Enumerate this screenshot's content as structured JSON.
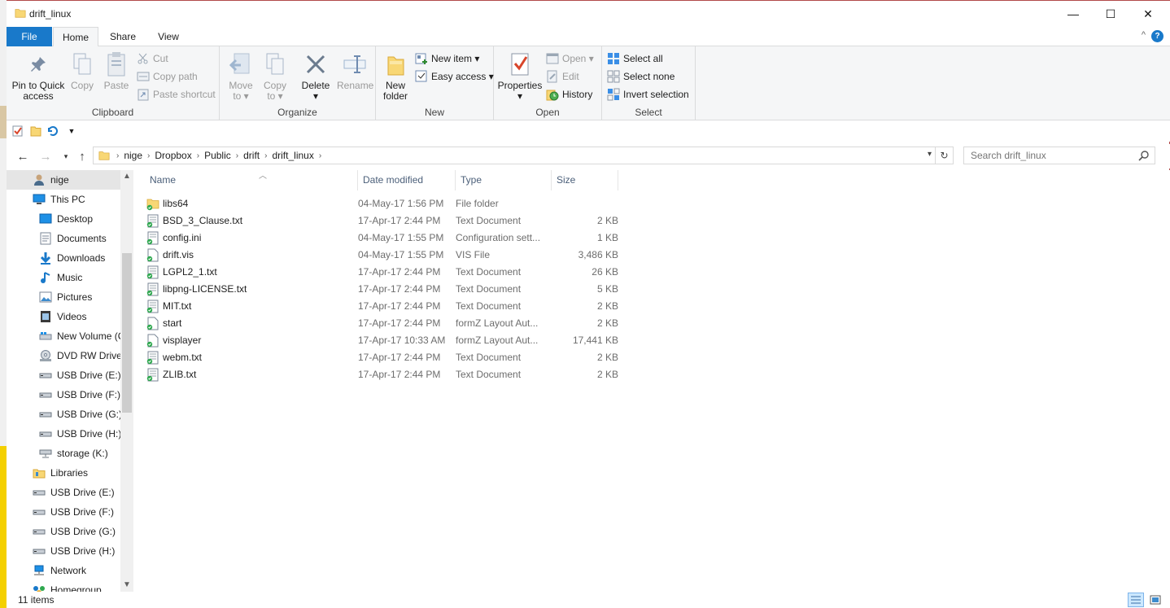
{
  "window": {
    "title": "drift_linux",
    "minimize_glyph": "—",
    "maximize_glyph": "☐",
    "close_glyph": "✕"
  },
  "ribbon_tabs": {
    "file": "File",
    "home": "Home",
    "share": "Share",
    "view": "View",
    "collapse_glyph": "^",
    "help_glyph": "?"
  },
  "ribbon": {
    "clipboard": {
      "title": "Clipboard",
      "pin_label_1": "Pin to Quick",
      "pin_label_2": "access",
      "copy": "Copy",
      "paste": "Paste",
      "cut": "Cut",
      "copy_path": "Copy path",
      "paste_shortcut": "Paste shortcut"
    },
    "organize": {
      "title": "Organize",
      "move_to_1": "Move",
      "move_to_2": "to",
      "copy_to_1": "Copy",
      "copy_to_2": "to",
      "delete": "Delete",
      "rename": "Rename"
    },
    "new": {
      "title": "New",
      "new_folder_1": "New",
      "new_folder_2": "folder",
      "new_item": "New item",
      "easy_access": "Easy access"
    },
    "open": {
      "title": "Open",
      "properties": "Properties",
      "open": "Open",
      "edit": "Edit",
      "history": "History"
    },
    "select": {
      "title": "Select",
      "select_all": "Select all",
      "select_none": "Select none",
      "invert_selection": "Invert selection"
    }
  },
  "address": {
    "crumbs": [
      "nige",
      "Dropbox",
      "Public",
      "drift",
      "drift_linux"
    ],
    "search_placeholder": "Search drift_linux"
  },
  "nav_pane": {
    "items": [
      {
        "label": "nige",
        "icon": "user-folder-icon"
      },
      {
        "label": "This PC",
        "icon": "computer-icon"
      },
      {
        "label": "Desktop",
        "icon": "desktop-icon"
      },
      {
        "label": "Documents",
        "icon": "documents-icon"
      },
      {
        "label": "Downloads",
        "icon": "downloads-icon"
      },
      {
        "label": "Music",
        "icon": "music-icon"
      },
      {
        "label": "Pictures",
        "icon": "pictures-icon"
      },
      {
        "label": "Videos",
        "icon": "videos-icon"
      },
      {
        "label": "New Volume (C",
        "icon": "drive-icon"
      },
      {
        "label": "DVD RW Drive",
        "icon": "dvd-drive-icon"
      },
      {
        "label": "USB Drive (E:)",
        "icon": "usb-drive-icon"
      },
      {
        "label": "USB Drive (F:)",
        "icon": "usb-drive-icon"
      },
      {
        "label": "USB Drive (G:)",
        "icon": "usb-drive-icon"
      },
      {
        "label": "USB Drive (H:)",
        "icon": "usb-drive-icon"
      },
      {
        "label": "storage (K:)",
        "icon": "network-drive-icon"
      },
      {
        "label": "Libraries",
        "icon": "libraries-icon"
      },
      {
        "label": "USB Drive (E:)",
        "icon": "usb-drive-icon"
      },
      {
        "label": "USB Drive (F:)",
        "icon": "usb-drive-icon"
      },
      {
        "label": "USB Drive (G:)",
        "icon": "usb-drive-icon"
      },
      {
        "label": "USB Drive (H:)",
        "icon": "usb-drive-icon"
      },
      {
        "label": "Network",
        "icon": "network-icon"
      },
      {
        "label": "Homegroup",
        "icon": "homegroup-icon"
      }
    ]
  },
  "columns": {
    "name": "Name",
    "date": "Date modified",
    "type": "Type",
    "size": "Size"
  },
  "files": [
    {
      "name": "libs64",
      "date": "04-May-17 1:56 PM",
      "type": "File folder",
      "size": "",
      "icon": "folder-icon"
    },
    {
      "name": "BSD_3_Clause.txt",
      "date": "17-Apr-17 2:44 PM",
      "type": "Text Document",
      "size": "2 KB",
      "icon": "text-file-icon"
    },
    {
      "name": "config.ini",
      "date": "04-May-17 1:55 PM",
      "type": "Configuration sett...",
      "size": "1 KB",
      "icon": "config-file-icon"
    },
    {
      "name": "drift.vis",
      "date": "04-May-17 1:55 PM",
      "type": "VIS File",
      "size": "3,486 KB",
      "icon": "file-icon"
    },
    {
      "name": "LGPL2_1.txt",
      "date": "17-Apr-17 2:44 PM",
      "type": "Text Document",
      "size": "26 KB",
      "icon": "text-file-icon"
    },
    {
      "name": "libpng-LICENSE.txt",
      "date": "17-Apr-17 2:44 PM",
      "type": "Text Document",
      "size": "5 KB",
      "icon": "text-file-icon"
    },
    {
      "name": "MIT.txt",
      "date": "17-Apr-17 2:44 PM",
      "type": "Text Document",
      "size": "2 KB",
      "icon": "text-file-icon"
    },
    {
      "name": "start",
      "date": "17-Apr-17 2:44 PM",
      "type": "formZ Layout Aut...",
      "size": "2 KB",
      "icon": "file-icon"
    },
    {
      "name": "visplayer",
      "date": "17-Apr-17 10:33 AM",
      "type": "formZ Layout Aut...",
      "size": "17,441 KB",
      "icon": "file-icon"
    },
    {
      "name": "webm.txt",
      "date": "17-Apr-17 2:44 PM",
      "type": "Text Document",
      "size": "2 KB",
      "icon": "text-file-icon"
    },
    {
      "name": "ZLIB.txt",
      "date": "17-Apr-17 2:44 PM",
      "type": "Text Document",
      "size": "2 KB",
      "icon": "text-file-icon"
    }
  ],
  "status": {
    "item_count": "11 items"
  },
  "colors": {
    "accent": "#1979ca",
    "selection": "#cce8ff",
    "folder": "#f8d775",
    "sync_check": "#2fa84f"
  }
}
